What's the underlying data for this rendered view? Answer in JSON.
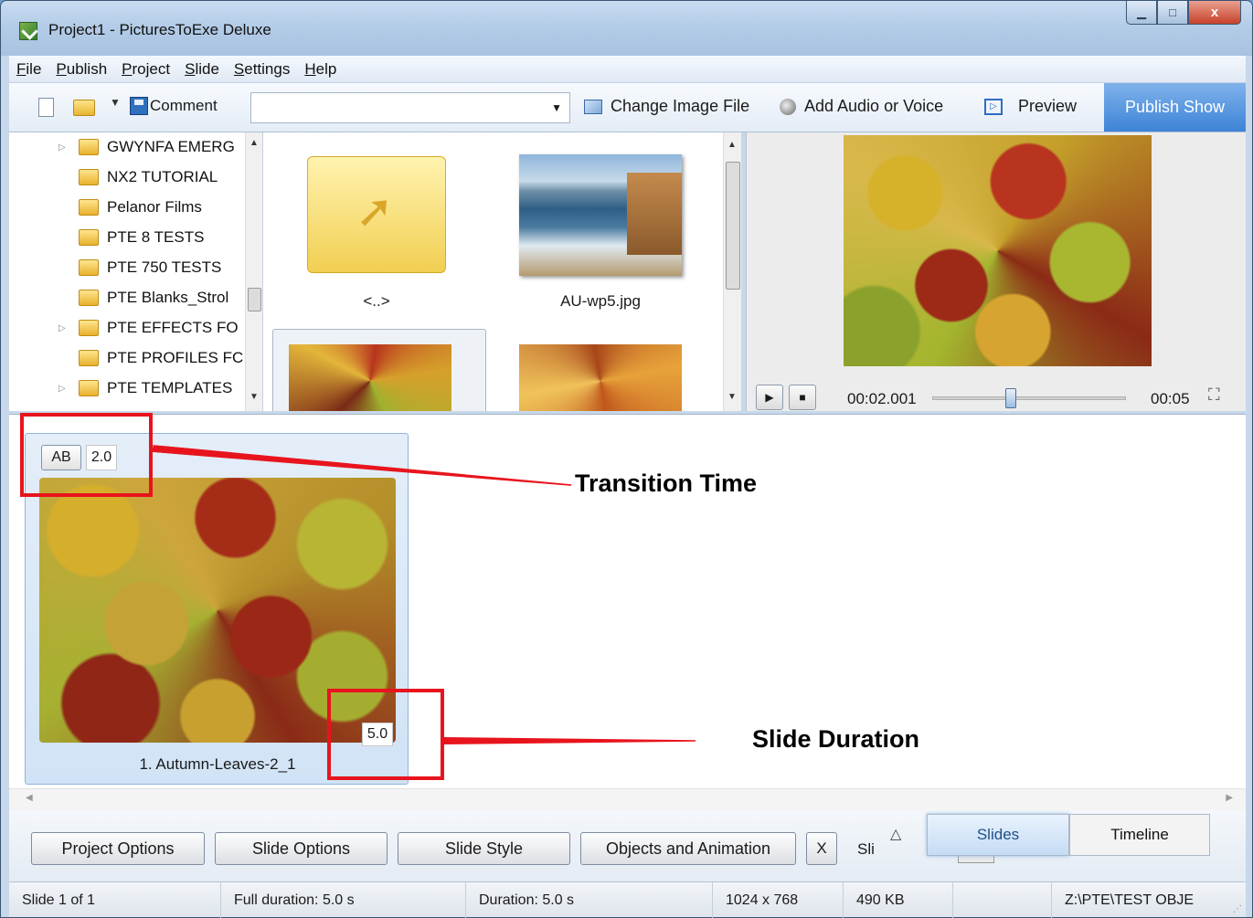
{
  "window": {
    "title": "Project1 - PicturesToExe Deluxe",
    "minimize_glyph": "▁",
    "maximize_glyph": "□",
    "close_glyph": "x"
  },
  "menu": [
    "File",
    "Publish",
    "Project",
    "Slide",
    "Settings",
    "Help"
  ],
  "toolbar": {
    "comment_label": "Comment",
    "comment_value": "",
    "change_image_label": "Change Image File",
    "add_audio_label": "Add Audio or Voice",
    "preview_label": "Preview",
    "publish_label": "Publish Show"
  },
  "folder_tree": [
    {
      "name": "GWYNFA EMERG",
      "expandable": true
    },
    {
      "name": "NX2 TUTORIAL",
      "expandable": false
    },
    {
      "name": "Pelanor Films",
      "expandable": false
    },
    {
      "name": "PTE 8 TESTS",
      "expandable": false
    },
    {
      "name": "PTE 750 TESTS",
      "expandable": false
    },
    {
      "name": "PTE Blanks_Strol",
      "expandable": false
    },
    {
      "name": "PTE EFFECTS FO",
      "expandable": true
    },
    {
      "name": "PTE PROFILES FC",
      "expandable": false
    },
    {
      "name": "PTE TEMPLATES",
      "expandable": true
    }
  ],
  "file_thumbs": {
    "parent_label": "<..>",
    "image_label": "AU-wp5.jpg"
  },
  "preview": {
    "current_time": "00:02.001",
    "total_time": "00:05",
    "seek_fraction": 0.4
  },
  "slide": {
    "ab_label": "AB",
    "transition_time": "2.0",
    "duration": "5.0",
    "name": "1. Autumn-Leaves-2_1"
  },
  "annotations": {
    "transition": "Transition Time",
    "duration": "Slide Duration"
  },
  "bottom_buttons": {
    "project_options": "Project Options",
    "slide_options": "Slide Options",
    "slide_style": "Slide Style",
    "objects_animation": "Objects and Animation",
    "x_label": "X",
    "sli_label": "Sli"
  },
  "tabs": {
    "slides": "Slides",
    "timeline": "Timeline"
  },
  "status": {
    "slide_index": "Slide 1 of 1",
    "full_duration": "Full duration: 5.0 s",
    "duration": "Duration: 5.0 s",
    "resolution": "1024 x 768",
    "file_size": "490 KB",
    "path": "Z:\\PTE\\TEST OBJE"
  },
  "colors": {
    "accent": "#3d83d6",
    "annotation_red": "#e8141d"
  }
}
